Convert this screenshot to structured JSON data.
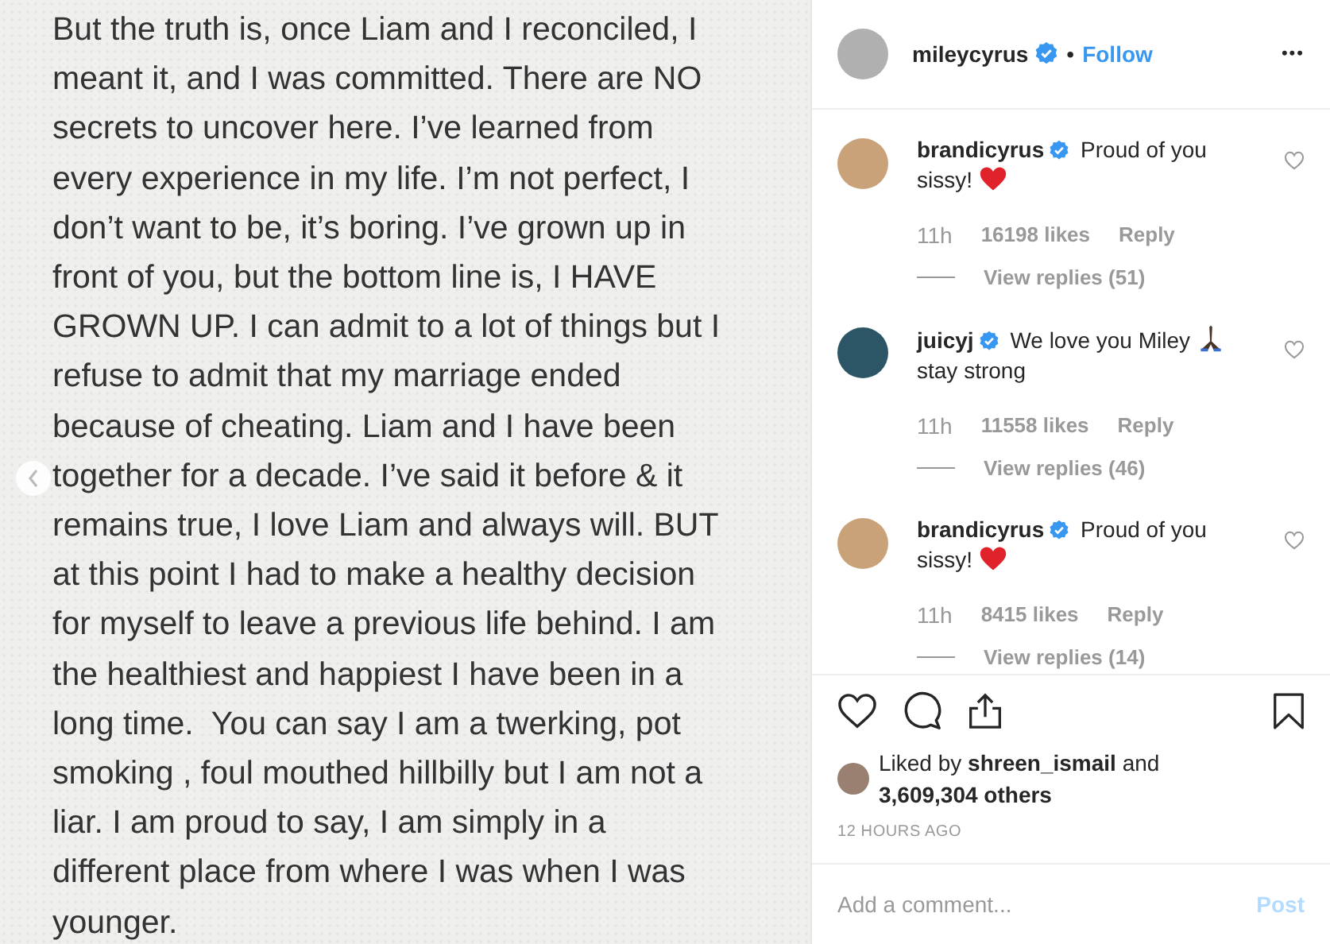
{
  "post_image": {
    "lines": [
      "But the truth is, once Liam and I reconciled, I",
      "meant it, and I was committed. There are NO",
      "secrets to uncover here. I’ve learned from",
      "every experience in my life. I’m not perfect, I",
      "don’t want to be, it’s boring. I’ve grown up in",
      "front of you, but the bottom line is, I HAVE",
      "GROWN UP. I can admit to a lot of things but I",
      "refuse to admit that my marriage ended",
      "because of cheating. Liam and I have been",
      "together for a decade. I’ve said it before & it",
      "remains true, I love Liam and always will. BUT",
      "at this point I had to make a healthy decision",
      "for myself to leave a previous life behind. I am",
      "the healthiest and happiest I have been in a",
      "long time.  You can say I am a twerking, pot",
      "smoking , foul mouthed hillbilly but I am not a",
      "liar. I am proud to say, I am simply in a",
      "different place from where I was when I was",
      "younger."
    ]
  },
  "header": {
    "username": "mileycyrus",
    "verified": true,
    "separator": "•",
    "follow": "Follow",
    "more": "•••"
  },
  "comments": [
    {
      "username": "brandicyrus",
      "verified": true,
      "text": "Proud of you",
      "after": "sissy!",
      "kind": "heart",
      "color": "#c9a27a",
      "time": "11h",
      "likes": "16198 likes",
      "reply": "Reply",
      "view_replies": "View replies (51)"
    },
    {
      "username": "juicyj",
      "verified": true,
      "text": "We love you Miley",
      "kind": "pray",
      "after": "stay strong",
      "color": "#2c5566",
      "time": "11h",
      "likes": "11558 likes",
      "reply": "Reply",
      "view_replies": "View replies (46)"
    },
    {
      "username": "brandicyrus",
      "verified": true,
      "text": "Proud of you",
      "after": "sissy!",
      "kind": "heart",
      "color": "#c9a27a",
      "time": "11h",
      "likes": "8415 likes",
      "reply": "Reply",
      "view_replies": "View replies (14)"
    }
  ],
  "likes": {
    "prefix": "Liked by",
    "user": "shreen_ismail",
    "middle": "and",
    "count": "3,609,304 others"
  },
  "timestamp": "12 HOURS AGO",
  "add_comment": {
    "placeholder": "Add a comment...",
    "post": "Post"
  }
}
